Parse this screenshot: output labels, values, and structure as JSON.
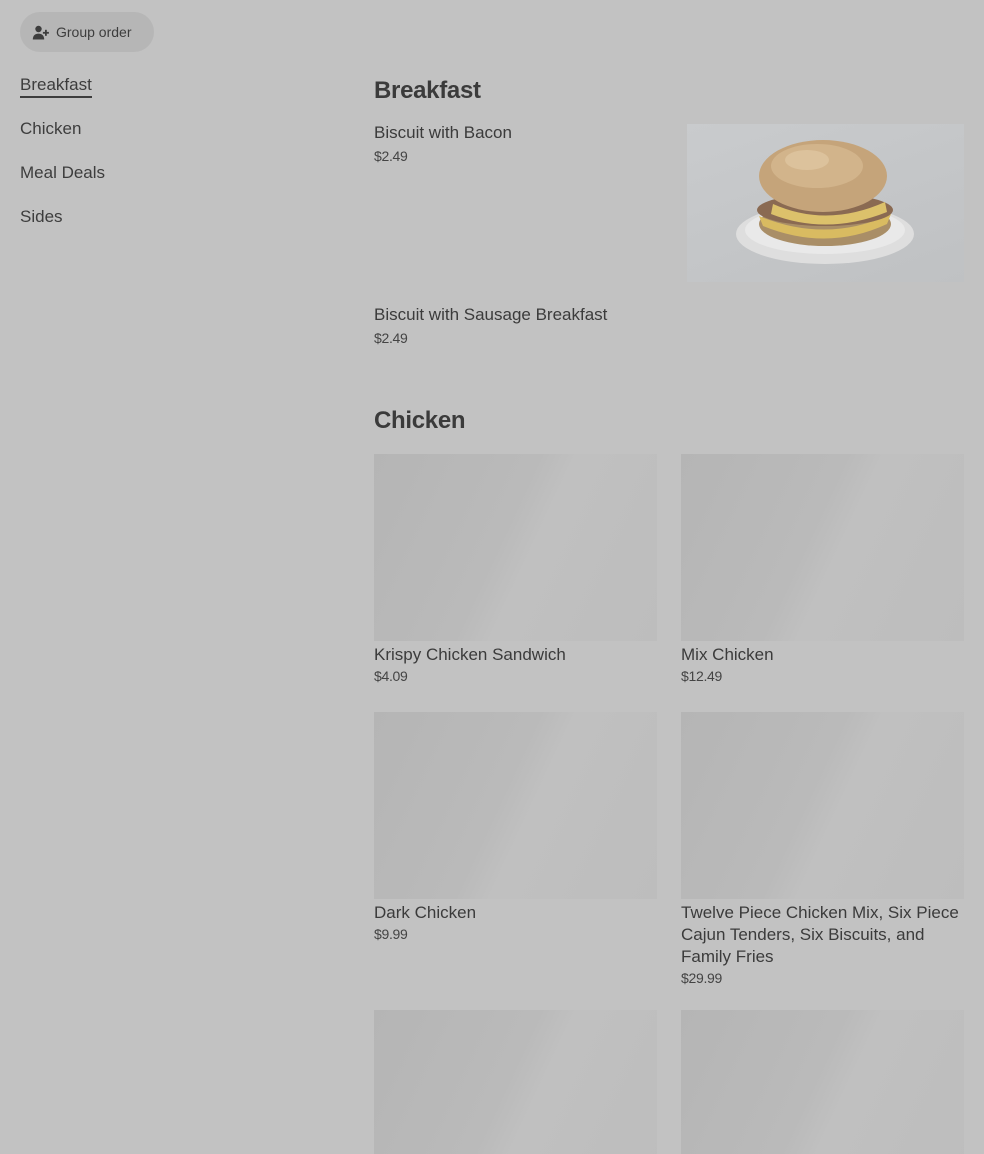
{
  "group_order": {
    "label": "Group order",
    "icon": "person-add-icon"
  },
  "sidebar": {
    "items": [
      {
        "label": "Breakfast",
        "active": true
      },
      {
        "label": "Chicken"
      },
      {
        "label": "Meal Deals"
      },
      {
        "label": "Sides"
      }
    ]
  },
  "sections": [
    {
      "title": "Breakfast",
      "items": [
        {
          "name": "Biscuit with Bacon",
          "price": "$2.49"
        },
        {
          "name": "Biscuit with Sausage Breakfast",
          "price": "$2.49"
        }
      ]
    },
    {
      "title": "Chicken",
      "items": [
        {
          "name": "Krispy Chicken Sandwich",
          "price": "$4.09"
        },
        {
          "name": "Mix Chicken",
          "price": "$12.49"
        },
        {
          "name": "Dark Chicken",
          "price": "$9.99"
        },
        {
          "name": "Twelve Piece Chicken Mix, Six Piece Cajun Tenders, Six Biscuits, and Family Fries",
          "price": "$29.99"
        },
        {
          "name": "",
          "price": ""
        },
        {
          "name": "",
          "price": ""
        }
      ]
    }
  ]
}
